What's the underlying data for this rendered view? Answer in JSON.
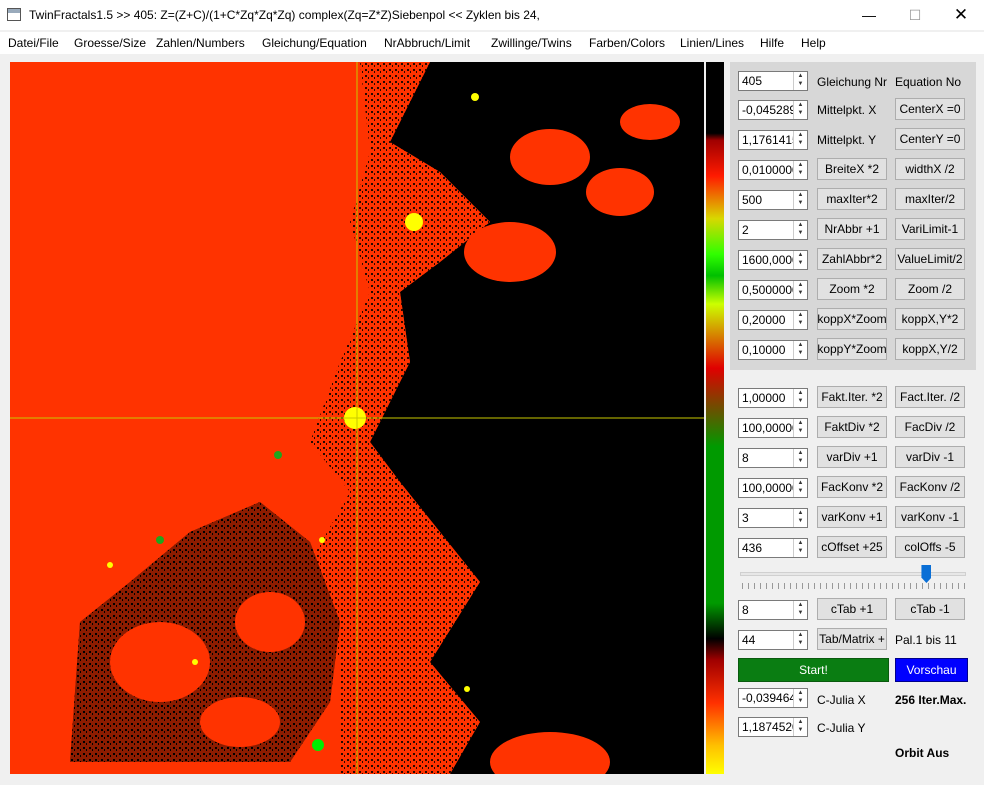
{
  "window": {
    "title": "TwinFractals1.5 >> 405: Z=(Z+C)/(1+C*Zq*Zq*Zq) complex(Zq=Z*Z)Siebenpol <<  Zyklen bis 24,",
    "min": "—",
    "max": "☐",
    "close": "✕"
  },
  "menu": [
    "Datei/File",
    "Groesse/Size",
    "Zahlen/Numbers",
    "Gleichung/Equation",
    "NrAbbruch/Limit",
    "Zwillinge/Twins",
    "Farben/Colors",
    "Linien/Lines",
    "Hilfe",
    "Help"
  ],
  "panel_top": {
    "eq_value": "405",
    "eq_label_de": "Gleichung Nr",
    "eq_label_en": "Equation No",
    "rows": [
      {
        "value": "-0,0452890",
        "label": "Mittelpkt. X",
        "button": "CenterX =0"
      },
      {
        "value": "1,17614150",
        "label": "Mittelpkt. Y",
        "button": "CenterY =0"
      },
      {
        "value": "0,0100000",
        "b1": "BreiteX *2",
        "b2": "widthX /2"
      },
      {
        "value": "500",
        "b1": "maxIter*2",
        "b2": "maxIter/2"
      },
      {
        "value": "2",
        "b1": "NrAbbr +1",
        "b2": "VariLimit-1"
      },
      {
        "value": "1600,0000",
        "b1": "ZahlAbbr*2",
        "b2": "ValueLimit/2"
      },
      {
        "value": "0,5000000",
        "b1": "Zoom *2",
        "b2": "Zoom /2"
      },
      {
        "value": "0,20000",
        "b1": "koppX*Zoom",
        "b2": "koppX,Y*2"
      },
      {
        "value": "0,10000",
        "b1": "koppY*Zoom",
        "b2": "koppX,Y/2"
      }
    ]
  },
  "panel_bottom": {
    "rows": [
      {
        "value": "1,00000",
        "b1": "Fakt.Iter. *2",
        "b2": "Fact.Iter. /2"
      },
      {
        "value": "100,00000",
        "b1": "FaktDiv *2",
        "b2": "FacDiv /2"
      },
      {
        "value": "8",
        "b1": "varDiv +1",
        "b2": "varDiv -1"
      },
      {
        "value": "100,00000",
        "b1": "FacKonv *2",
        "b2": "FacKonv /2"
      },
      {
        "value": "3",
        "b1": "varKonv +1",
        "b2": "varKonv -1"
      },
      {
        "value": "436",
        "b1": "cOffset +25",
        "b2": "colOffs -5"
      }
    ],
    "slider_fraction": 0.84,
    "ctab_value": "8",
    "ctab_b1": "cTab +1",
    "ctab_b2": "cTab -1",
    "tab_value": "44",
    "tab_b1": "Tab/Matrix +",
    "pal_label": "Pal.1 bis 11",
    "start": "Start!",
    "vorschau": "Vorschau",
    "julia_x_value": "-0,0394649",
    "julia_x_label": "C-Julia X",
    "iter_max": "256 Iter.Max.",
    "julia_y_value": "1,18745200",
    "julia_y_label": "C-Julia Y",
    "orbit": "Orbit Aus"
  },
  "colors": {
    "fractal_red": "#ff3300",
    "fractal_black": "#000000",
    "crosshair": "#c8c800",
    "start_green": "#0a7d12",
    "vorschau_blue": "#0000ff"
  }
}
